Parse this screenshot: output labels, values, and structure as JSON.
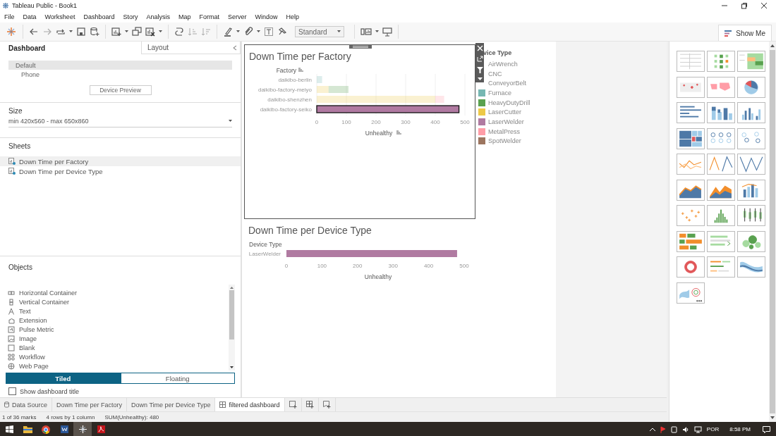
{
  "window": {
    "title": "Tableau Public - Book1"
  },
  "menu": [
    "File",
    "Data",
    "Worksheet",
    "Dashboard",
    "Story",
    "Analysis",
    "Map",
    "Format",
    "Server",
    "Window",
    "Help"
  ],
  "toolbar": {
    "fit": "Standard",
    "show_me": "Show Me"
  },
  "side_panel": {
    "tabs": [
      {
        "label": "Dashboard",
        "selected": true
      },
      {
        "label": "Layout",
        "selected": false
      }
    ],
    "devices": [
      {
        "label": "Default",
        "selected": true
      },
      {
        "label": "Phone",
        "selected": false
      }
    ],
    "device_preview": "Device Preview",
    "size": {
      "heading": "Size",
      "value": "min 420x560 - max 650x860"
    },
    "sheets": {
      "heading": "Sheets",
      "items": [
        {
          "label": "Down Time per Factory",
          "selected": true
        },
        {
          "label": "Down Time per Device Type",
          "selected": false
        }
      ]
    },
    "objects": {
      "heading": "Objects",
      "items": [
        {
          "label": "Horizontal Container",
          "kind": "hcontainer"
        },
        {
          "label": "Vertical Container",
          "kind": "vcontainer"
        },
        {
          "label": "Text",
          "kind": "text"
        },
        {
          "label": "Extension",
          "kind": "extension"
        },
        {
          "label": "Pulse Metric",
          "kind": "pulse"
        },
        {
          "label": "Image",
          "kind": "image"
        },
        {
          "label": "Blank",
          "kind": "blank"
        },
        {
          "label": "Workflow",
          "kind": "workflow"
        },
        {
          "label": "Web Page",
          "kind": "webpage"
        }
      ]
    },
    "layout_mode": [
      {
        "label": "Tiled",
        "selected": true
      },
      {
        "label": "Floating",
        "selected": false
      }
    ],
    "show_title": {
      "label": "Show dashboard title",
      "checked": false
    }
  },
  "dashboard": {
    "factory_sheet": {
      "selected": true,
      "selected_rows": [
        false,
        false,
        false,
        true
      ],
      "chart_data": {
        "type": "bar",
        "orientation": "horizontal",
        "stacked": true,
        "title": "Down Time per Factory",
        "ylabel": "Factory",
        "xlabel": "Unhealthy",
        "categories": [
          "daikibo-berlin",
          "daikibo-factory-meiyo",
          "daikibo-shenzhen",
          "daikibo-factory-seiko"
        ],
        "series": [
          {
            "color": "#76b7b2",
            "values": [
              18,
              0,
              0,
              0
            ]
          },
          {
            "color": "#edc948",
            "values": [
              0,
              40,
              400,
              0
            ]
          },
          {
            "color": "#59a14f",
            "values": [
              0,
              67,
              0,
              0
            ]
          },
          {
            "color": "#ff9da7",
            "values": [
              0,
              0,
              30,
              0
            ]
          },
          {
            "color": "#b07aa1",
            "values": [
              0,
              0,
              0,
              480
            ]
          }
        ],
        "grid": true,
        "xlim": [
          0,
          500
        ],
        "xticks": [
          0,
          100,
          200,
          300,
          400,
          500
        ]
      }
    },
    "device_sheet": {
      "chart_data": {
        "type": "bar",
        "orientation": "horizontal",
        "title": "Down Time per Device Type",
        "ylabel": "Device Type",
        "xlabel": "Unhealthy",
        "categories": [
          "LaserWelder"
        ],
        "series": [
          {
            "color": "#b07aa1",
            "values": [
              480
            ]
          }
        ],
        "xlim": [
          0,
          500
        ],
        "xticks": [
          0,
          100,
          200,
          300,
          400,
          500
        ]
      }
    },
    "legend": {
      "title": "vice Type",
      "items": [
        {
          "label": "AirWrench"
        },
        {
          "label": "CNC"
        },
        {
          "label": "ConveyorBelt"
        },
        {
          "label": "Furnace",
          "color": "#76b7b2"
        },
        {
          "label": "HeavyDutyDrill",
          "color": "#59a14f"
        },
        {
          "label": "LaserCutter",
          "color": "#edc948"
        },
        {
          "label": "LaserWelder",
          "color": "#b07aa1"
        },
        {
          "label": "MetalPress",
          "color": "#ff9da7"
        },
        {
          "label": "SpotWelder",
          "color": "#9c755f"
        }
      ]
    }
  },
  "sheet_tabs": [
    {
      "label": "Data Source",
      "kind": "source",
      "selected": false
    },
    {
      "label": "Down Time per Factory",
      "kind": "sheet",
      "selected": false
    },
    {
      "label": "Down Time per Device Type",
      "kind": "sheet",
      "selected": false
    },
    {
      "label": "filtered dashboard",
      "kind": "dashboard",
      "selected": true
    }
  ],
  "status_bar": [
    "1 of 36 marks",
    "4 rows by 1 column",
    "SUM(Unhealthy): 480"
  ],
  "taskbar": {
    "language": "POR",
    "time": "8:58 PM"
  }
}
